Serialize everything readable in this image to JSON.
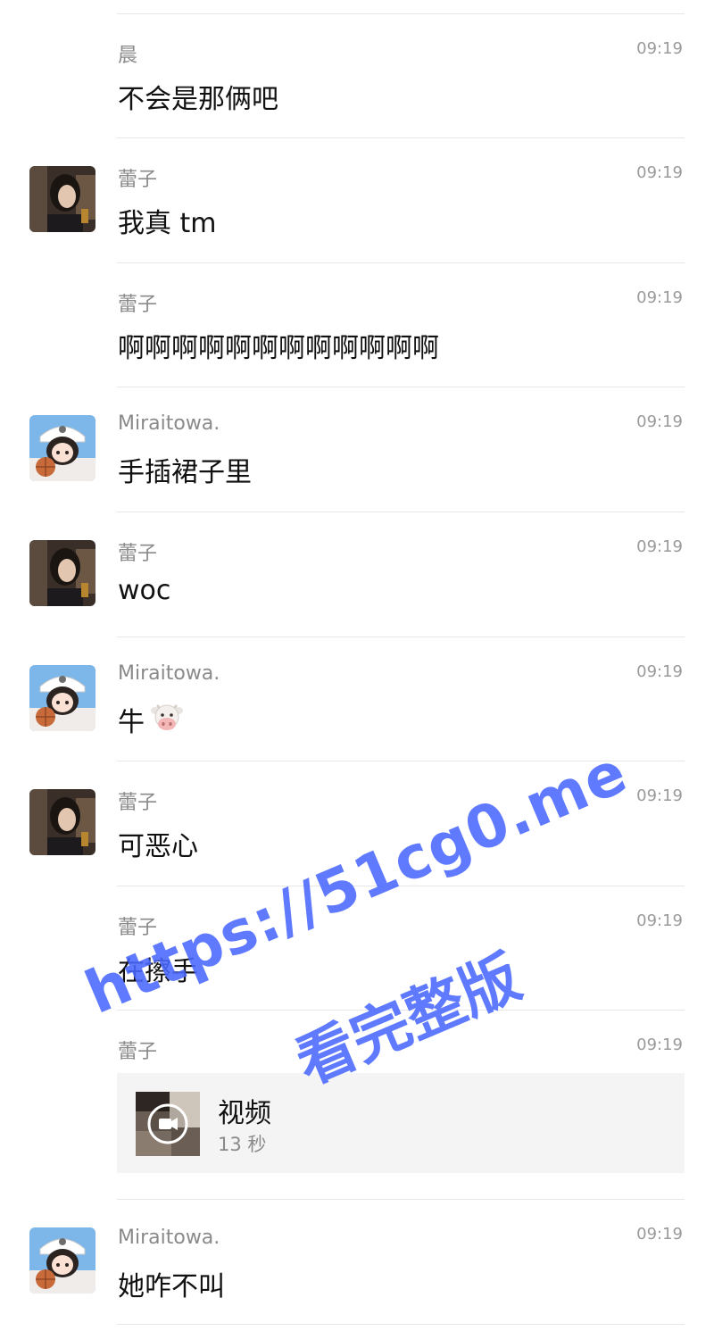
{
  "messages": [
    {
      "sender": "晨",
      "time": "09:19",
      "text": "不会是那俩吧",
      "avatar": "none"
    },
    {
      "sender": "蕾子",
      "time": "09:19",
      "text": "我真 tm",
      "avatar": "photo-girl-avatar"
    },
    {
      "sender": "蕾子",
      "time": "09:19",
      "text": "啊啊啊啊啊啊啊啊啊啊啊啊",
      "avatar": "none"
    },
    {
      "sender": "Miraitowa.",
      "time": "09:19",
      "text": "手插裙子里",
      "avatar": "anime-girl-avatar"
    },
    {
      "sender": "蕾子",
      "time": "09:19",
      "text": "woc",
      "avatar": "photo-girl-avatar"
    },
    {
      "sender": "Miraitowa.",
      "time": "09:19",
      "text": "牛",
      "emoji": "cow-face-emoji",
      "avatar": "anime-girl-avatar"
    },
    {
      "sender": "蕾子",
      "time": "09:19",
      "text": "可恶心",
      "avatar": "photo-girl-avatar"
    },
    {
      "sender": "蕾子",
      "time": "09:19",
      "text": "在擦手",
      "avatar": "none"
    },
    {
      "sender": "蕾子",
      "time": "09:19",
      "video": {
        "title": "视频",
        "duration": "13 秒",
        "icon": "video-camera-icon"
      },
      "avatar": "none"
    },
    {
      "sender": "Miraitowa.",
      "time": "09:19",
      "text": "她咋不叫",
      "avatar": "anime-girl-avatar"
    }
  ],
  "watermark": {
    "line1": "https://51cg0.me",
    "line2": "看完整版",
    "color": "#4a68ff"
  },
  "colors": {
    "sender": "#8a8a8a",
    "time": "#9a9a9a",
    "text": "#111111",
    "divider": "#e6e6e6",
    "card": "#f4f4f4"
  }
}
